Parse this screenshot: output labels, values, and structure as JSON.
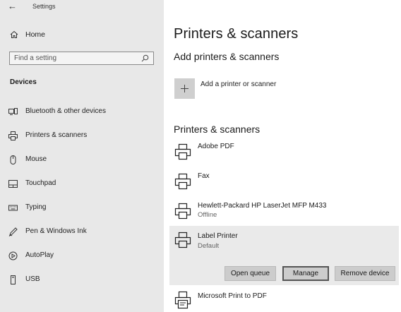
{
  "window": {
    "title": "Settings"
  },
  "sidebar": {
    "home_label": "Home",
    "search_placeholder": "Find a setting",
    "section_heading": "Devices",
    "items": [
      {
        "label": "Bluetooth & other devices",
        "icon": "bluetooth-devices-icon"
      },
      {
        "label": "Printers & scanners",
        "icon": "printer-icon"
      },
      {
        "label": "Mouse",
        "icon": "mouse-icon"
      },
      {
        "label": "Touchpad",
        "icon": "touchpad-icon"
      },
      {
        "label": "Typing",
        "icon": "keyboard-icon"
      },
      {
        "label": "Pen & Windows Ink",
        "icon": "pen-icon"
      },
      {
        "label": "AutoPlay",
        "icon": "autoplay-icon"
      },
      {
        "label": "USB",
        "icon": "usb-icon"
      }
    ]
  },
  "main": {
    "title": "Printers & scanners",
    "add_section_heading": "Add printers & scanners",
    "add_button_label": "Add a printer or scanner",
    "list_heading": "Printers & scanners",
    "devices": [
      {
        "name": "Adobe PDF",
        "status": ""
      },
      {
        "name": "Fax",
        "status": ""
      },
      {
        "name": "Hewlett-Packard HP LaserJet MFP M433",
        "status": "Offline"
      },
      {
        "name": "Label Printer",
        "status": "Default"
      },
      {
        "name": "Microsoft Print to PDF",
        "status": ""
      }
    ],
    "actions": {
      "open_queue": "Open queue",
      "manage": "Manage",
      "remove_device": "Remove device"
    }
  },
  "colors": {
    "sidebar_bg": "#e8e8e8",
    "selected_bg": "#eaeaea",
    "button_bg": "#cccccc"
  }
}
